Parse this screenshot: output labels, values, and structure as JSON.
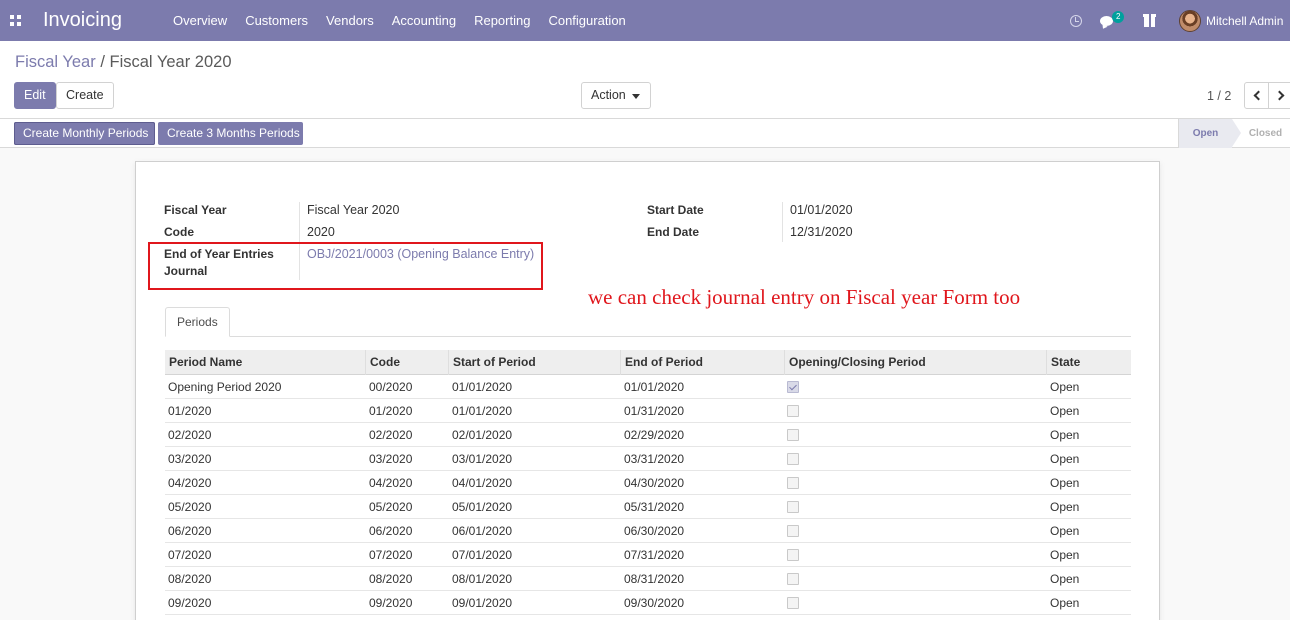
{
  "navbar": {
    "brand": "Invoicing",
    "menu": [
      {
        "label": "Overview"
      },
      {
        "label": "Customers"
      },
      {
        "label": "Vendors"
      },
      {
        "label": "Accounting"
      },
      {
        "label": "Reporting"
      },
      {
        "label": "Configuration"
      }
    ],
    "messages_badge": "2",
    "user_name": "Mitchell Admin"
  },
  "breadcrumb": {
    "parent": "Fiscal Year",
    "separator": "/",
    "current": "Fiscal Year 2020"
  },
  "buttons": {
    "edit": "Edit",
    "create": "Create",
    "action": "Action"
  },
  "pager": {
    "value": "1 / 2"
  },
  "header_buttons": {
    "monthly": "Create Monthly Periods",
    "three_months": "Create 3 Months Periods"
  },
  "statusbar": {
    "stages": [
      "Open",
      "Closed"
    ],
    "active": "Open"
  },
  "form": {
    "fiscal_year_label": "Fiscal Year",
    "fiscal_year_value": "Fiscal Year 2020",
    "code_label": "Code",
    "code_value": "2020",
    "journal_label_line1": "End of Year Entries",
    "journal_label_line2": "Journal",
    "journal_value": "OBJ/2021/0003 (Opening Balance Entry)",
    "start_date_label": "Start Date",
    "start_date_value": "01/01/2020",
    "end_date_label": "End Date",
    "end_date_value": "12/31/2020"
  },
  "annotation": "we can check journal entry on Fiscal year Form too",
  "tabs": [
    "Periods"
  ],
  "periods_table": {
    "columns": [
      "Period Name",
      "Code",
      "Start of Period",
      "End of Period",
      "Opening/Closing Period",
      "State"
    ],
    "rows": [
      {
        "name": "Opening Period 2020",
        "code": "00/2020",
        "start": "01/01/2020",
        "end": "01/01/2020",
        "opening_closing": true,
        "state": "Open"
      },
      {
        "name": "01/2020",
        "code": "01/2020",
        "start": "01/01/2020",
        "end": "01/31/2020",
        "opening_closing": false,
        "state": "Open"
      },
      {
        "name": "02/2020",
        "code": "02/2020",
        "start": "02/01/2020",
        "end": "02/29/2020",
        "opening_closing": false,
        "state": "Open"
      },
      {
        "name": "03/2020",
        "code": "03/2020",
        "start": "03/01/2020",
        "end": "03/31/2020",
        "opening_closing": false,
        "state": "Open"
      },
      {
        "name": "04/2020",
        "code": "04/2020",
        "start": "04/01/2020",
        "end": "04/30/2020",
        "opening_closing": false,
        "state": "Open"
      },
      {
        "name": "05/2020",
        "code": "05/2020",
        "start": "05/01/2020",
        "end": "05/31/2020",
        "opening_closing": false,
        "state": "Open"
      },
      {
        "name": "06/2020",
        "code": "06/2020",
        "start": "06/01/2020",
        "end": "06/30/2020",
        "opening_closing": false,
        "state": "Open"
      },
      {
        "name": "07/2020",
        "code": "07/2020",
        "start": "07/01/2020",
        "end": "07/31/2020",
        "opening_closing": false,
        "state": "Open"
      },
      {
        "name": "08/2020",
        "code": "08/2020",
        "start": "08/01/2020",
        "end": "08/31/2020",
        "opening_closing": false,
        "state": "Open"
      },
      {
        "name": "09/2020",
        "code": "09/2020",
        "start": "09/01/2020",
        "end": "09/30/2020",
        "opening_closing": false,
        "state": "Open"
      }
    ]
  },
  "colors": {
    "brand": "#7c7bad",
    "annotation": "#e0161c"
  },
  "icons": [
    "apps-icon",
    "clock-icon",
    "chat-icon",
    "gift-icon",
    "avatar",
    "chevron-left-icon",
    "chevron-right-icon",
    "caret-down-icon"
  ]
}
